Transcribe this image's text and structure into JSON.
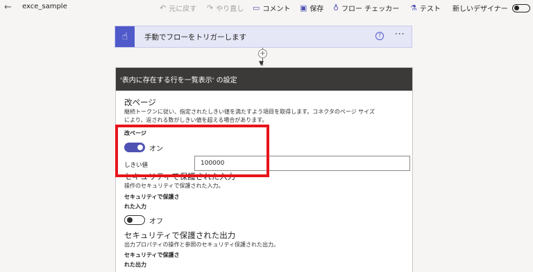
{
  "topbar": {
    "flow_name": "exce_sample",
    "undo": "元に戻す",
    "redo": "やり直し",
    "comment": "コメント",
    "save": "保存",
    "flow_checker": "フロー チェッカー",
    "test": "テスト",
    "new_designer": "新しいデザイナー"
  },
  "trigger": {
    "title": "手動でフローをトリガーします",
    "help": "?",
    "more": "···"
  },
  "connector": {
    "plus": "+"
  },
  "panel": {
    "header": "'表内に存在する行を一覧表示' の設定",
    "pagination": {
      "title": "改ページ",
      "desc1": "継続トークンに従い、指定されたしきい値を満たすよう項目を取得します。コネクタのページ サイズ",
      "desc2": "により、返される数がしきい値を超える場合があります。",
      "toggle_label": "改ページ",
      "toggle_state": "オン",
      "threshold_label": "しきい値",
      "threshold_value": "100000"
    },
    "secure_inputs": {
      "title": "セキュリティで保護された入力",
      "desc": "操作のセキュリティで保護された入力。",
      "toggle_label_1": "セキュリティで保護さ",
      "toggle_label_2": "れた入力",
      "toggle_state": "オフ"
    },
    "secure_outputs": {
      "title": "セキュリティで保護された出力",
      "desc": "出力プロパティの操作と参照のセキュリティ保護された出力。",
      "toggle_label_1": "セキュリティで保護さ",
      "toggle_label_2": "れた出力"
    }
  },
  "colors": {
    "accent": "#4f52b2",
    "highlight": "#e8141b",
    "header_bg": "#3b3a39"
  }
}
